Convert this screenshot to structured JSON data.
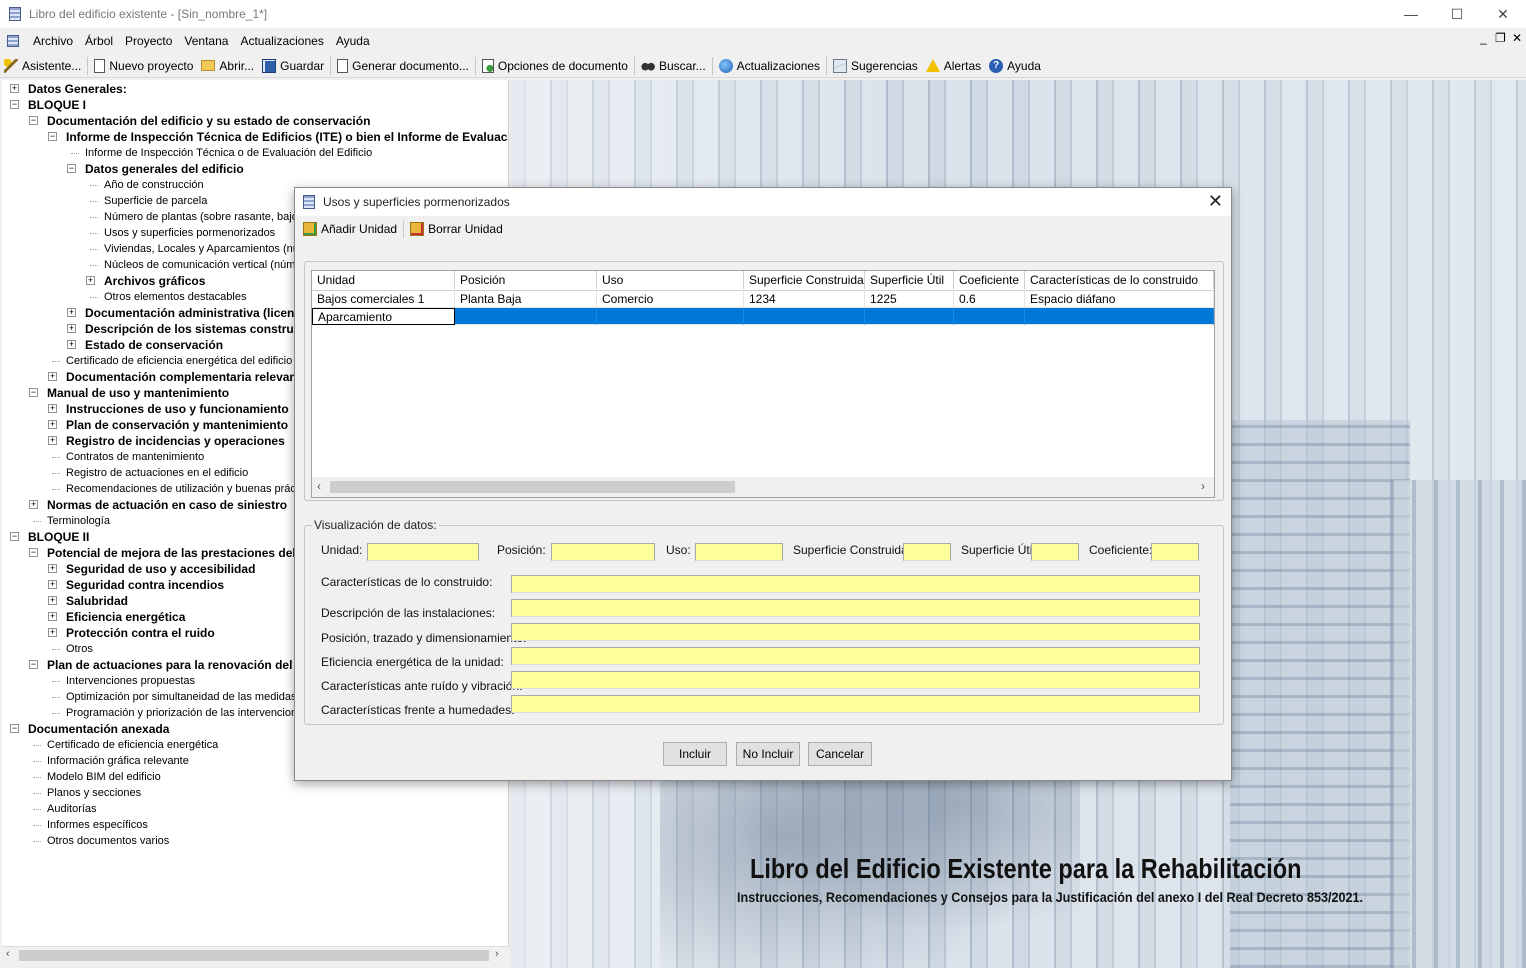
{
  "window": {
    "title": "Libro del edificio existente - [Sin_nombre_1*]",
    "minimize": "—",
    "maximize": "☐",
    "close": "✕"
  },
  "menu": [
    "Archivo",
    "Árbol",
    "Proyecto",
    "Ventana",
    "Actualizaciones",
    "Ayuda"
  ],
  "mdi_controls": [
    "_",
    "❐",
    "✕"
  ],
  "toolbar": {
    "asistente": "Asistente...",
    "nuevo": "Nuevo proyecto",
    "abrir": "Abrir...",
    "guardar": "Guardar",
    "generar": "Generar documento...",
    "opciones": "Opciones de documento",
    "buscar": "Buscar...",
    "actualizaciones": "Actualizaciones",
    "sugerencias": "Sugerencias",
    "alertas": "Alertas",
    "ayuda": "Ayuda"
  },
  "tree": [
    {
      "t": "Datos Generales:",
      "lvl": 0,
      "exp": "+",
      "b": true
    },
    {
      "t": "BLOQUE I",
      "lvl": 0,
      "exp": "-",
      "b": true
    },
    {
      "t": "Documentación del edificio y su estado de conservación",
      "lvl": 1,
      "exp": "-",
      "b": true
    },
    {
      "t": "Informe de Inspección Técnica de Edificios (ITE) o bien el Informe de Evaluación",
      "lvl": 2,
      "exp": "-",
      "b": true
    },
    {
      "t": "Informe de Inspección Técnica o de Evaluación del Edificio",
      "lvl": 3,
      "exp": "",
      "b": false
    },
    {
      "t": "Datos generales del edificio",
      "lvl": 3,
      "exp": "-",
      "b": true
    },
    {
      "t": "Año de construcción",
      "lvl": 4,
      "exp": "",
      "b": false
    },
    {
      "t": "Superficie de parcela",
      "lvl": 4,
      "exp": "",
      "b": false
    },
    {
      "t": "Número de plantas (sobre rasante, bajo rasante)",
      "lvl": 4,
      "exp": "",
      "b": false
    },
    {
      "t": "Usos y superficies pormenorizados",
      "lvl": 4,
      "exp": "",
      "b": false
    },
    {
      "t": "Viviendas, Locales y Aparcamientos (número)",
      "lvl": 4,
      "exp": "",
      "b": false
    },
    {
      "t": "Núcleos de comunicación vertical (número)",
      "lvl": 4,
      "exp": "",
      "b": false
    },
    {
      "t": "Archivos gráficos",
      "lvl": 4,
      "exp": "+",
      "b": true
    },
    {
      "t": "Otros elementos destacables",
      "lvl": 4,
      "exp": "",
      "b": false
    },
    {
      "t": "Documentación administrativa (licencias)",
      "lvl": 3,
      "exp": "+",
      "b": true
    },
    {
      "t": "Descripción de los sistemas constructivos",
      "lvl": 3,
      "exp": "+",
      "b": true
    },
    {
      "t": "Estado de conservación",
      "lvl": 3,
      "exp": "+",
      "b": true
    },
    {
      "t": "Certificado de eficiencia energética del edificio",
      "lvl": 2,
      "exp": "",
      "b": false
    },
    {
      "t": "Documentación complementaria relevante",
      "lvl": 2,
      "exp": "+",
      "b": true
    },
    {
      "t": "Manual de uso y mantenimiento",
      "lvl": 1,
      "exp": "-",
      "b": true
    },
    {
      "t": "Instrucciones de uso y funcionamiento",
      "lvl": 2,
      "exp": "+",
      "b": true
    },
    {
      "t": "Plan de conservación y mantenimiento",
      "lvl": 2,
      "exp": "+",
      "b": true
    },
    {
      "t": "Registro de incidencias y operaciones",
      "lvl": 2,
      "exp": "+",
      "b": true
    },
    {
      "t": "Contratos de mantenimiento",
      "lvl": 2,
      "exp": "",
      "b": false
    },
    {
      "t": "Registro de actuaciones en el edificio",
      "lvl": 2,
      "exp": "",
      "b": false
    },
    {
      "t": "Recomendaciones de utilización y buenas prácticas",
      "lvl": 2,
      "exp": "",
      "b": false
    },
    {
      "t": "Normas de actuación en caso de siniestro",
      "lvl": 1,
      "exp": "+",
      "b": true
    },
    {
      "t": "Terminología",
      "lvl": 1,
      "exp": "",
      "b": false
    },
    {
      "t": "BLOQUE II",
      "lvl": 0,
      "exp": "-",
      "b": true
    },
    {
      "t": "Potencial de mejora de las prestaciones del edificio",
      "lvl": 1,
      "exp": "-",
      "b": true
    },
    {
      "t": "Seguridad de uso y accesibilidad",
      "lvl": 2,
      "exp": "+",
      "b": true
    },
    {
      "t": "Seguridad contra incendios",
      "lvl": 2,
      "exp": "+",
      "b": true
    },
    {
      "t": "Salubridad",
      "lvl": 2,
      "exp": "+",
      "b": true
    },
    {
      "t": "Eficiencia energética",
      "lvl": 2,
      "exp": "+",
      "b": true
    },
    {
      "t": "Protección contra el ruido",
      "lvl": 2,
      "exp": "+",
      "b": true
    },
    {
      "t": "Otros",
      "lvl": 2,
      "exp": "",
      "b": false
    },
    {
      "t": "Plan de actuaciones para la renovación del edificio",
      "lvl": 1,
      "exp": "-",
      "b": true
    },
    {
      "t": "Intervenciones propuestas",
      "lvl": 2,
      "exp": "",
      "b": false
    },
    {
      "t": "Optimización por simultaneidad de las medidas",
      "lvl": 2,
      "exp": "",
      "b": false
    },
    {
      "t": "Programación y priorización de las intervenciones",
      "lvl": 2,
      "exp": "",
      "b": false
    },
    {
      "t": "Documentación anexada",
      "lvl": 0,
      "exp": "-",
      "b": true
    },
    {
      "t": "Certificado de eficiencia energética",
      "lvl": 1,
      "exp": "",
      "b": false
    },
    {
      "t": "Información gráfica relevante",
      "lvl": 1,
      "exp": "",
      "b": false
    },
    {
      "t": "Modelo BIM del edificio",
      "lvl": 1,
      "exp": "",
      "b": false
    },
    {
      "t": "Planos y secciones",
      "lvl": 1,
      "exp": "",
      "b": false
    },
    {
      "t": "Auditorías",
      "lvl": 1,
      "exp": "",
      "b": false
    },
    {
      "t": "Informes específicos",
      "lvl": 1,
      "exp": "",
      "b": false
    },
    {
      "t": "Otros documentos varios",
      "lvl": 1,
      "exp": "",
      "b": false
    }
  ],
  "background": {
    "title": "Libro del Edificio Existente para la Rehabilitación",
    "subtitle": "Instrucciones, Recomendaciones y Consejos para la Justificación del anexo I del Real Decreto 853/2021."
  },
  "dialog": {
    "title": "Usos y superficies pormenorizados",
    "add_unit": "Añadir Unidad",
    "delete_unit": "Borrar Unidad",
    "columns": [
      "Unidad",
      "Posición",
      "Uso",
      "Superficie Construida",
      "Superficie Útil",
      "Coeficiente",
      "Características de lo construido"
    ],
    "rows": [
      [
        "Bajos comerciales 1",
        "Planta Baja",
        "Comercio",
        "1234",
        "1225",
        "0.6",
        "Espacio diáfano"
      ],
      [
        "Aparcamiento",
        "",
        "",
        "",
        "",
        "",
        ""
      ]
    ],
    "legend": "Visualización de datos:",
    "labels": {
      "unidad": "Unidad:",
      "posicion": "Posición:",
      "uso": "Uso:",
      "sup_construida": "Superficie Construida:",
      "sup_util": "Superficie Útil",
      "coeficiente": "Coeficiente:",
      "caracteristicas": "Características de lo construido:",
      "instalaciones": "Descripción de las instalaciones:",
      "trazado": "Posición, trazado y dimensionamiento:",
      "eficiencia": "Eficiencia energética de la unidad:",
      "ruido": "Características ante ruído y vibración:",
      "humedades": "Características frente a humedades:"
    },
    "buttons": {
      "incluir": "Incluir",
      "no_incluir": "No Incluir",
      "cancelar": "Cancelar"
    }
  },
  "colors": {
    "input_bg": "#ffff99",
    "selection": "#0078d7"
  }
}
